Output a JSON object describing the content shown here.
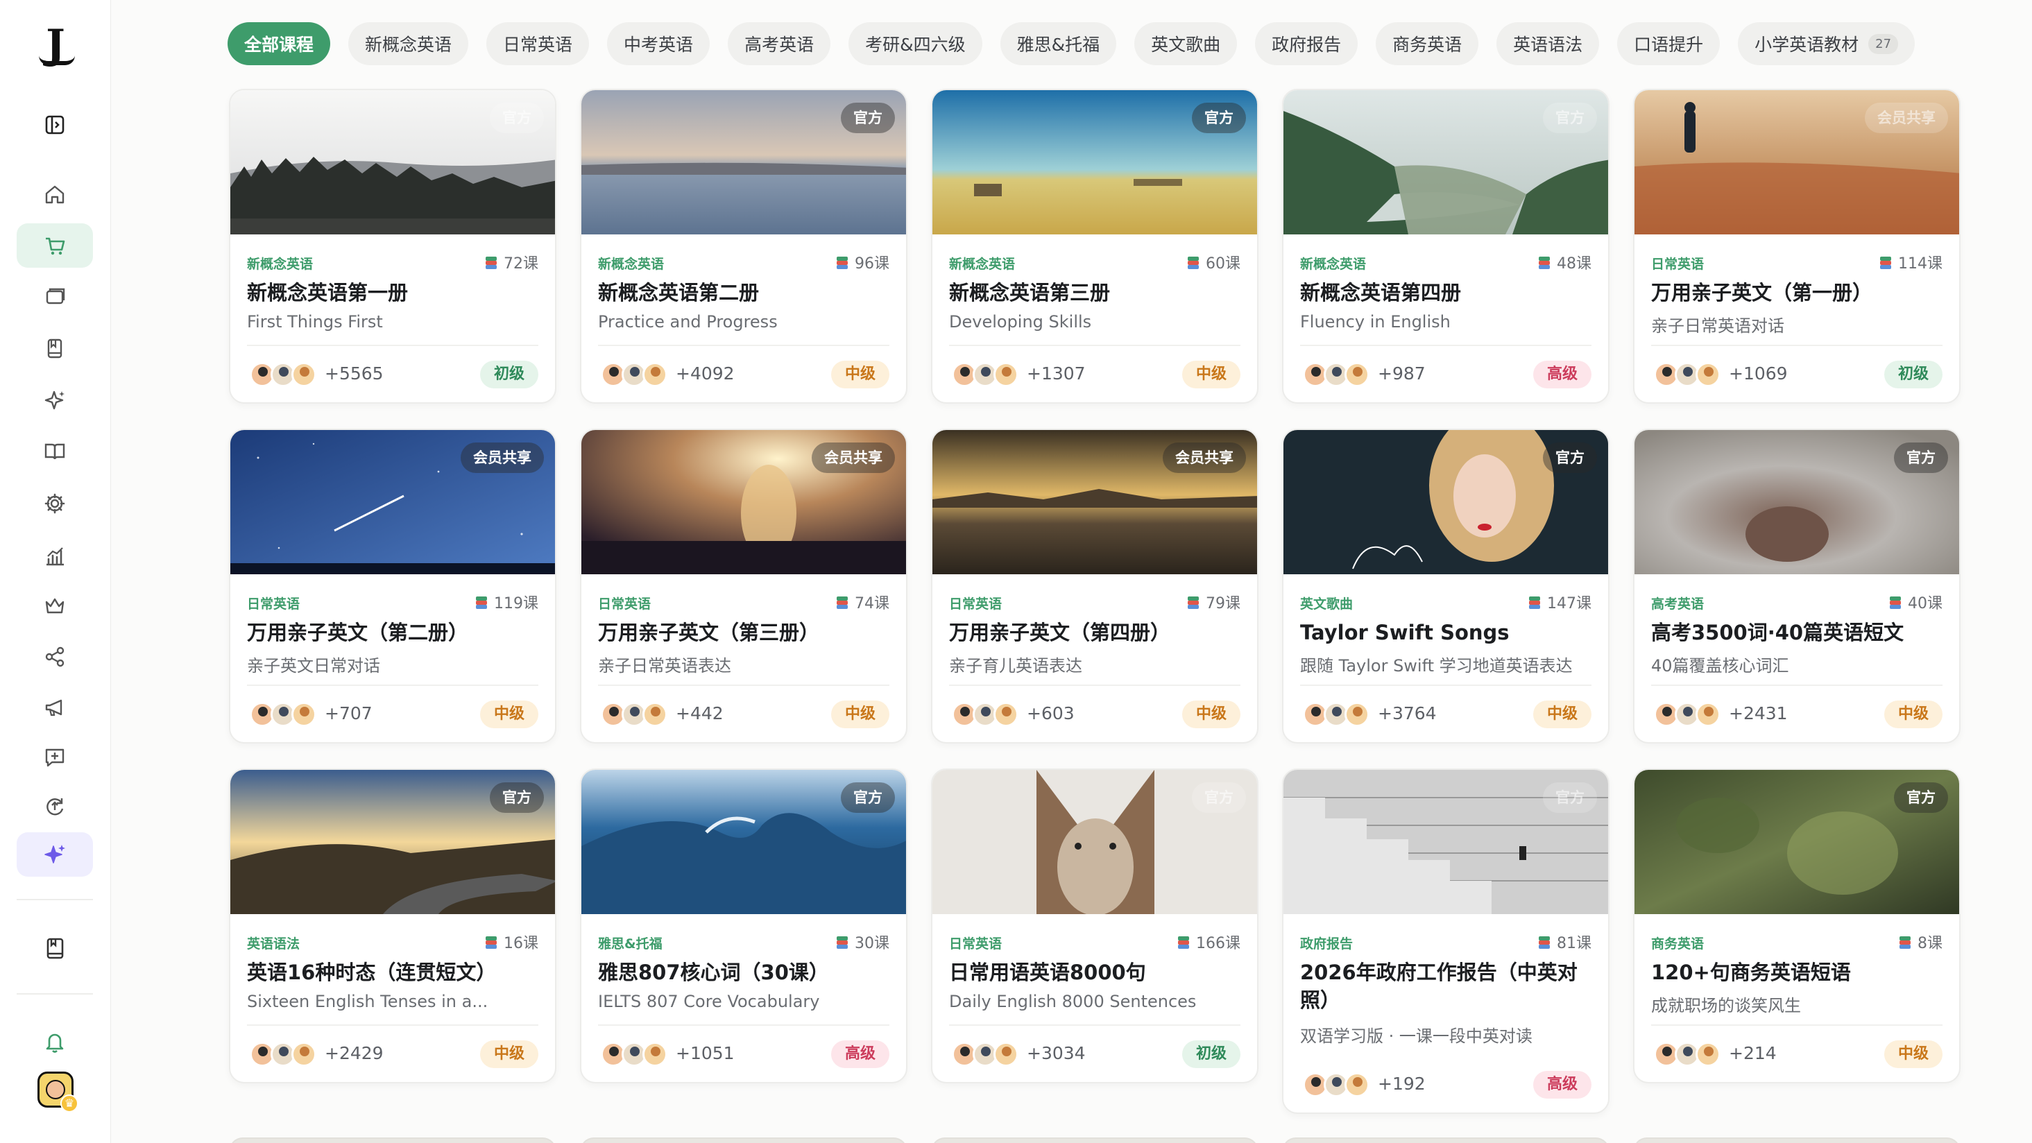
{
  "app": {
    "logo_text": "J"
  },
  "sidebar": {
    "items": [
      {
        "name": "collapse-sidebar-icon",
        "active": false
      },
      {
        "name": "home-icon",
        "active": false
      },
      {
        "name": "cart-icon",
        "active": true
      },
      {
        "name": "folder-icon",
        "active": false
      },
      {
        "name": "bookmark-book-icon",
        "active": false
      },
      {
        "name": "sparkle-icon",
        "active": false
      },
      {
        "name": "open-book-icon",
        "active": false
      },
      {
        "name": "settings-gear-icon",
        "active": false
      },
      {
        "name": "stats-chart-icon",
        "active": false
      },
      {
        "name": "crown-icon",
        "active": false
      },
      {
        "name": "share-icon",
        "active": false
      },
      {
        "name": "megaphone-icon",
        "active": false
      },
      {
        "name": "feedback-icon",
        "active": false
      },
      {
        "name": "upload-cycle-icon",
        "active": false
      },
      {
        "name": "ai-sparkle-icon",
        "active": false
      },
      {
        "name": "notebook-icon",
        "active": false
      },
      {
        "name": "bell-icon",
        "active": false
      }
    ]
  },
  "categories": {
    "chips": [
      {
        "label": "全部课程",
        "active": true
      },
      {
        "label": "新概念英语"
      },
      {
        "label": "日常英语"
      },
      {
        "label": "中考英语"
      },
      {
        "label": "高考英语"
      },
      {
        "label": "考研&四六级"
      },
      {
        "label": "雅思&托福"
      },
      {
        "label": "英文歌曲"
      },
      {
        "label": "政府报告"
      },
      {
        "label": "商务英语"
      },
      {
        "label": "英语语法"
      },
      {
        "label": "口语提升"
      },
      {
        "label": "小学英语教材",
        "count": "27"
      }
    ]
  },
  "courses": [
    {
      "badge": "官方",
      "badge_faint": true,
      "category": "新概念英语",
      "lessons": "72课",
      "title": "新概念英语第一册",
      "subtitle": "First Things First",
      "learners": "+5565",
      "level": "初级",
      "level_color": "green",
      "image": "forest"
    },
    {
      "badge": "官方",
      "category": "新概念英语",
      "lessons": "96课",
      "title": "新概念英语第二册",
      "subtitle": "Practice and Progress",
      "learners": "+4092",
      "level": "中级",
      "level_color": "orange",
      "image": "lake"
    },
    {
      "badge": "官方",
      "category": "新概念英语",
      "lessons": "60课",
      "title": "新概念英语第三册",
      "subtitle": "Developing Skills",
      "learners": "+1307",
      "level": "中级",
      "level_color": "orange",
      "image": "field"
    },
    {
      "badge": "官方",
      "badge_faint": true,
      "category": "新概念英语",
      "lessons": "48课",
      "title": "新概念英语第四册",
      "subtitle": "Fluency in English",
      "learners": "+987",
      "level": "高级",
      "level_color": "red",
      "image": "river"
    },
    {
      "badge": "会员共享",
      "badge_faint": true,
      "category": "日常英语",
      "lessons": "114课",
      "title": "万用亲子英文（第一册）",
      "subtitle": "亲子日常英语对话",
      "learners": "+1069",
      "level": "初级",
      "level_color": "green",
      "image": "shore"
    },
    {
      "badge": "会员共享",
      "category": "日常英语",
      "lessons": "119课",
      "title": "万用亲子英文（第二册）",
      "subtitle": "亲子英文日常对话",
      "learners": "+707",
      "level": "中级",
      "level_color": "orange",
      "image": "sky"
    },
    {
      "badge": "会员共享",
      "category": "日常英语",
      "lessons": "74课",
      "title": "万用亲子英文（第三册）",
      "subtitle": "亲子日常英语表达",
      "learners": "+442",
      "level": "中级",
      "level_color": "orange",
      "image": "sunset-girl"
    },
    {
      "badge": "会员共享",
      "category": "日常英语",
      "lessons": "79课",
      "title": "万用亲子英文（第四册）",
      "subtitle": "亲子育儿英语表达",
      "learners": "+603",
      "level": "中级",
      "level_color": "orange",
      "image": "beach"
    },
    {
      "badge": "官方",
      "category": "英文歌曲",
      "lessons": "147课",
      "title": "Taylor Swift Songs",
      "subtitle": "跟随 Taylor Swift 学习地道英语表达",
      "learners": "+3764",
      "level": "中级",
      "level_color": "orange",
      "image": "portrait"
    },
    {
      "badge": "官方",
      "category": "高考英语",
      "lessons": "40课",
      "title": "高考3500词·40篇英语短文",
      "subtitle": "40篇覆盖核心词汇",
      "learners": "+2431",
      "level": "中级",
      "level_color": "orange",
      "image": "fur"
    },
    {
      "badge": "官方",
      "category": "英语语法",
      "lessons": "16课",
      "title": "英语16种时态（连贯短文）",
      "subtitle": "Sixteen English Tenses in a...",
      "learners": "+2429",
      "level": "中级",
      "level_color": "orange",
      "image": "road"
    },
    {
      "badge": "官方",
      "category": "雅思&托福",
      "lessons": "30课",
      "title": "雅思807核心词（30课）",
      "subtitle": "IELTS 807 Core Vocabulary",
      "learners": "+1051",
      "level": "高级",
      "level_color": "red",
      "image": "wave"
    },
    {
      "badge": "官方",
      "badge_faint": true,
      "category": "日常英语",
      "lessons": "166课",
      "title": "日常用语英语8000句",
      "subtitle": "Daily English 8000 Sentences",
      "learners": "+3034",
      "level": "初级",
      "level_color": "green",
      "image": "coyote"
    },
    {
      "badge": "官方",
      "badge_faint": true,
      "category": "政府报告",
      "lessons": "81课",
      "title": "2026年政府工作报告（中英对照）",
      "subtitle": "双语学习版 · 一课一段中英对读",
      "learners": "+192",
      "level": "高级",
      "level_color": "red",
      "image": "stairs",
      "tall": true
    },
    {
      "badge": "官方",
      "category": "商务英语",
      "lessons": "8课",
      "title": "120+句商务英语短语",
      "subtitle": "成就职场的谈笑风生",
      "learners": "+214",
      "level": "中级",
      "level_color": "orange",
      "image": "moss"
    }
  ],
  "colors": {
    "accent": "#3e9c6b",
    "level_green": "#2f8a5a",
    "level_orange": "#c9771a",
    "level_red": "#cc3c5c"
  }
}
